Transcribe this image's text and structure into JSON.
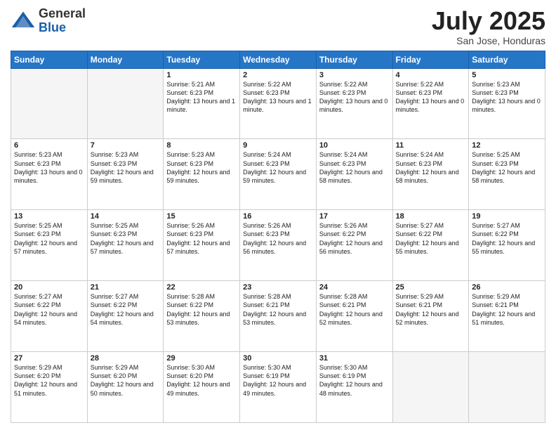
{
  "logo": {
    "general": "General",
    "blue": "Blue"
  },
  "title": "July 2025",
  "subtitle": "San Jose, Honduras",
  "days_of_week": [
    "Sunday",
    "Monday",
    "Tuesday",
    "Wednesday",
    "Thursday",
    "Friday",
    "Saturday"
  ],
  "weeks": [
    [
      {
        "day": "",
        "info": "",
        "empty": true
      },
      {
        "day": "",
        "info": "",
        "empty": true
      },
      {
        "day": "1",
        "info": "Sunrise: 5:21 AM\nSunset: 6:23 PM\nDaylight: 13 hours and 1 minute."
      },
      {
        "day": "2",
        "info": "Sunrise: 5:22 AM\nSunset: 6:23 PM\nDaylight: 13 hours and 1 minute."
      },
      {
        "day": "3",
        "info": "Sunrise: 5:22 AM\nSunset: 6:23 PM\nDaylight: 13 hours and 0 minutes."
      },
      {
        "day": "4",
        "info": "Sunrise: 5:22 AM\nSunset: 6:23 PM\nDaylight: 13 hours and 0 minutes."
      },
      {
        "day": "5",
        "info": "Sunrise: 5:23 AM\nSunset: 6:23 PM\nDaylight: 13 hours and 0 minutes."
      }
    ],
    [
      {
        "day": "6",
        "info": "Sunrise: 5:23 AM\nSunset: 6:23 PM\nDaylight: 13 hours and 0 minutes."
      },
      {
        "day": "7",
        "info": "Sunrise: 5:23 AM\nSunset: 6:23 PM\nDaylight: 12 hours and 59 minutes."
      },
      {
        "day": "8",
        "info": "Sunrise: 5:23 AM\nSunset: 6:23 PM\nDaylight: 12 hours and 59 minutes."
      },
      {
        "day": "9",
        "info": "Sunrise: 5:24 AM\nSunset: 6:23 PM\nDaylight: 12 hours and 59 minutes."
      },
      {
        "day": "10",
        "info": "Sunrise: 5:24 AM\nSunset: 6:23 PM\nDaylight: 12 hours and 58 minutes."
      },
      {
        "day": "11",
        "info": "Sunrise: 5:24 AM\nSunset: 6:23 PM\nDaylight: 12 hours and 58 minutes."
      },
      {
        "day": "12",
        "info": "Sunrise: 5:25 AM\nSunset: 6:23 PM\nDaylight: 12 hours and 58 minutes."
      }
    ],
    [
      {
        "day": "13",
        "info": "Sunrise: 5:25 AM\nSunset: 6:23 PM\nDaylight: 12 hours and 57 minutes."
      },
      {
        "day": "14",
        "info": "Sunrise: 5:25 AM\nSunset: 6:23 PM\nDaylight: 12 hours and 57 minutes."
      },
      {
        "day": "15",
        "info": "Sunrise: 5:26 AM\nSunset: 6:23 PM\nDaylight: 12 hours and 57 minutes."
      },
      {
        "day": "16",
        "info": "Sunrise: 5:26 AM\nSunset: 6:23 PM\nDaylight: 12 hours and 56 minutes."
      },
      {
        "day": "17",
        "info": "Sunrise: 5:26 AM\nSunset: 6:22 PM\nDaylight: 12 hours and 56 minutes."
      },
      {
        "day": "18",
        "info": "Sunrise: 5:27 AM\nSunset: 6:22 PM\nDaylight: 12 hours and 55 minutes."
      },
      {
        "day": "19",
        "info": "Sunrise: 5:27 AM\nSunset: 6:22 PM\nDaylight: 12 hours and 55 minutes."
      }
    ],
    [
      {
        "day": "20",
        "info": "Sunrise: 5:27 AM\nSunset: 6:22 PM\nDaylight: 12 hours and 54 minutes."
      },
      {
        "day": "21",
        "info": "Sunrise: 5:27 AM\nSunset: 6:22 PM\nDaylight: 12 hours and 54 minutes."
      },
      {
        "day": "22",
        "info": "Sunrise: 5:28 AM\nSunset: 6:22 PM\nDaylight: 12 hours and 53 minutes."
      },
      {
        "day": "23",
        "info": "Sunrise: 5:28 AM\nSunset: 6:21 PM\nDaylight: 12 hours and 53 minutes."
      },
      {
        "day": "24",
        "info": "Sunrise: 5:28 AM\nSunset: 6:21 PM\nDaylight: 12 hours and 52 minutes."
      },
      {
        "day": "25",
        "info": "Sunrise: 5:29 AM\nSunset: 6:21 PM\nDaylight: 12 hours and 52 minutes."
      },
      {
        "day": "26",
        "info": "Sunrise: 5:29 AM\nSunset: 6:21 PM\nDaylight: 12 hours and 51 minutes."
      }
    ],
    [
      {
        "day": "27",
        "info": "Sunrise: 5:29 AM\nSunset: 6:20 PM\nDaylight: 12 hours and 51 minutes."
      },
      {
        "day": "28",
        "info": "Sunrise: 5:29 AM\nSunset: 6:20 PM\nDaylight: 12 hours and 50 minutes."
      },
      {
        "day": "29",
        "info": "Sunrise: 5:30 AM\nSunset: 6:20 PM\nDaylight: 12 hours and 49 minutes."
      },
      {
        "day": "30",
        "info": "Sunrise: 5:30 AM\nSunset: 6:19 PM\nDaylight: 12 hours and 49 minutes."
      },
      {
        "day": "31",
        "info": "Sunrise: 5:30 AM\nSunset: 6:19 PM\nDaylight: 12 hours and 48 minutes."
      },
      {
        "day": "",
        "info": "",
        "empty": true
      },
      {
        "day": "",
        "info": "",
        "empty": true
      }
    ]
  ]
}
